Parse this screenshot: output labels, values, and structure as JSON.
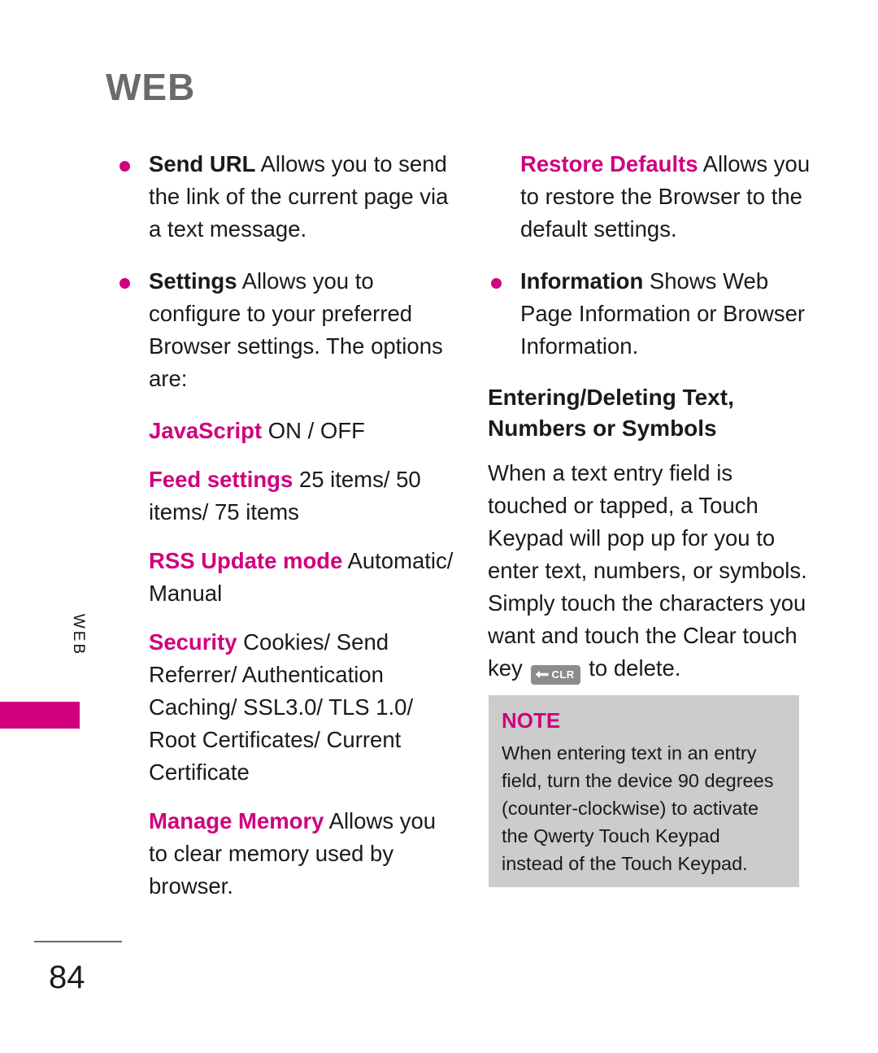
{
  "page": {
    "header": "WEB",
    "side_tab_label": "WEB",
    "number": "84"
  },
  "left_column": {
    "bullets": [
      {
        "lead": "Send URL",
        "text": " Allows you to send the link of the current page via a text message."
      },
      {
        "lead": "Settings",
        "text": " Allows you to configure to your preferred Browser settings. The options are:"
      }
    ],
    "settings_options": [
      {
        "name": "JavaScript",
        "values": " ON / OFF"
      },
      {
        "name": "Feed settings",
        "values": "  25 items/ 50 items/ 75 items"
      },
      {
        "name": "RSS Update mode",
        "values": " Automatic/ Manual"
      },
      {
        "name": "Security",
        "values": "  Cookies/ Send Referrer/ Authentication Caching/ SSL3.0/ TLS 1.0/ Root Certificates/ Current Certificate"
      }
    ],
    "manage_memory": {
      "lead": "Manage Memory",
      "text": " Allows you to clear memory used by browser."
    }
  },
  "right_column": {
    "restore_defaults": {
      "lead": "Restore Defaults",
      "text": " Allows you to restore the Browser to the default settings."
    },
    "information": {
      "lead": "Information",
      "text": " Shows Web Page Information or Browser Information."
    },
    "heading": "Entering/Deleting Text, Numbers or Symbols",
    "paragraph_before_key": "When a text entry field is touched or tapped, a Touch Keypad will pop up for you to enter text, numbers, or symbols. Simply touch the characters you want and touch the Clear touch key ",
    "clr_key_label": "CLR",
    "paragraph_after_key": " to delete."
  },
  "note": {
    "title": "NOTE",
    "body": "When entering text in an entry field, turn the device 90 degrees (counter-clockwise) to activate the Qwerty Touch Keypad instead of the Touch Keypad."
  },
  "colors": {
    "magenta": "#d0007e",
    "header_gray": "#6b6b6b",
    "note_bg": "#cccccc",
    "key_gray": "#8c8c8c"
  }
}
